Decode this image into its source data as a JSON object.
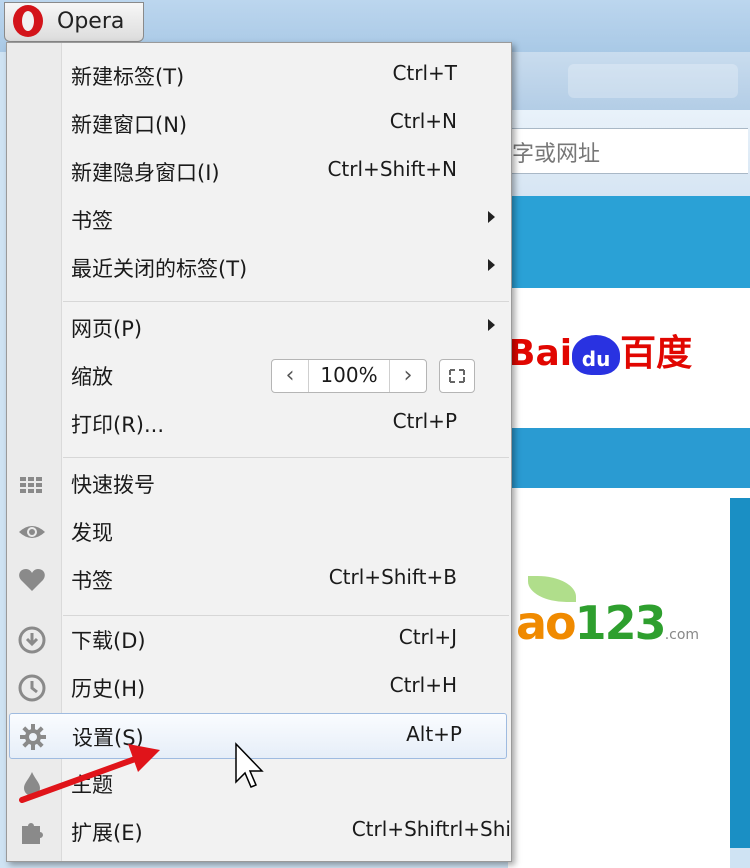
{
  "browser": {
    "menu_button_label": "Opera",
    "address_placeholder_partial": "字或网址",
    "content": {
      "baidu_logo_text_a": "Bai",
      "baidu_logo_text_b": "du",
      "baidu_logo_text_c": "百度",
      "hao_logo_ao": "ao",
      "hao_logo_num": "123",
      "hao_logo_suffix": ".com"
    }
  },
  "menu": {
    "group1": [
      {
        "label": "新建标签(T)",
        "shortcut": "Ctrl+T"
      },
      {
        "label": "新建窗口(N)",
        "shortcut": "Ctrl+N"
      },
      {
        "label": "新建隐身窗口(I)",
        "shortcut": "Ctrl+Shift+N"
      },
      {
        "label": "书签",
        "shortcut": ""
      },
      {
        "label": "最近关闭的标签(T)",
        "shortcut": ""
      }
    ],
    "group2": [
      {
        "label": "网页(P)",
        "shortcut": ""
      },
      {
        "label": "缩放",
        "shortcut": ""
      },
      {
        "label": "打印(R)...",
        "shortcut": "Ctrl+P"
      }
    ],
    "zoom": {
      "minus": "‹",
      "value": "100%",
      "plus": "›"
    },
    "group3": [
      {
        "label": "快速拨号",
        "icon": "speed-dial-grid-icon"
      },
      {
        "label": "发现",
        "icon": "eye-icon"
      },
      {
        "label": "书签",
        "shortcut": "Ctrl+Shift+B",
        "icon": "heart-icon"
      }
    ],
    "group4": [
      {
        "label": "下载(D)",
        "shortcut": "Ctrl+J",
        "icon": "download-icon"
      },
      {
        "label": "历史(H)",
        "shortcut": "Ctrl+H",
        "icon": "clock-icon"
      },
      {
        "label": "设置(S)",
        "shortcut": "Alt+P",
        "icon": "gear-icon"
      },
      {
        "label": "主题",
        "shortcut": "",
        "icon": "drop-icon"
      },
      {
        "label": "扩展(E)",
        "shortcut": "Ctrl+Shiftrl+Shi",
        "icon": "puzzle-icon"
      }
    ]
  },
  "colors": {
    "menu_bg": "#f2f2f2",
    "highlight_border": "#9fbbe0",
    "opera_red": "#d3141a",
    "annotation_arrow": "#e0141a"
  }
}
